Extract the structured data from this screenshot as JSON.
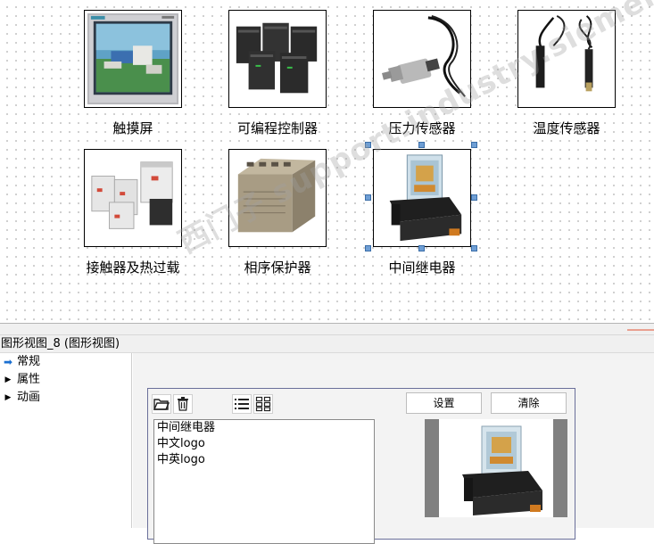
{
  "canvas": {
    "items": [
      {
        "label": "触摸屏",
        "icon": "touchscreen-image"
      },
      {
        "label": "可编程控制器",
        "icon": "plc-image"
      },
      {
        "label": "压力传感器",
        "icon": "pressure-sensor-image"
      },
      {
        "label": "温度传感器",
        "icon": "temperature-sensor-image"
      },
      {
        "label": "接触器及热过载",
        "icon": "contactor-image"
      },
      {
        "label": "相序保护器",
        "icon": "phase-protector-image"
      },
      {
        "label": "中间继电器",
        "icon": "relay-image"
      }
    ],
    "selected_item": "中间继电器",
    "watermark": "西门子 support.industry.siemens.com"
  },
  "properties": {
    "title": "图形视图_8 (图形视图)",
    "nav": [
      {
        "label": "常规",
        "active": true
      },
      {
        "label": "属性",
        "active": false
      },
      {
        "label": "动画",
        "active": false
      }
    ],
    "toolbar": {
      "open_icon": "folder-open-icon",
      "delete_icon": "trash-icon",
      "list_view_icon": "list-view-icon",
      "grid_view_icon": "grid-view-icon"
    },
    "settings_label": "设置",
    "clear_label": "清除",
    "graphics_list": [
      "中间继电器",
      "中文logo",
      "中英logo"
    ],
    "accent": "#1a6fd1",
    "handle_color": "#6e9ed4",
    "group_border": "#6a6f9a"
  }
}
